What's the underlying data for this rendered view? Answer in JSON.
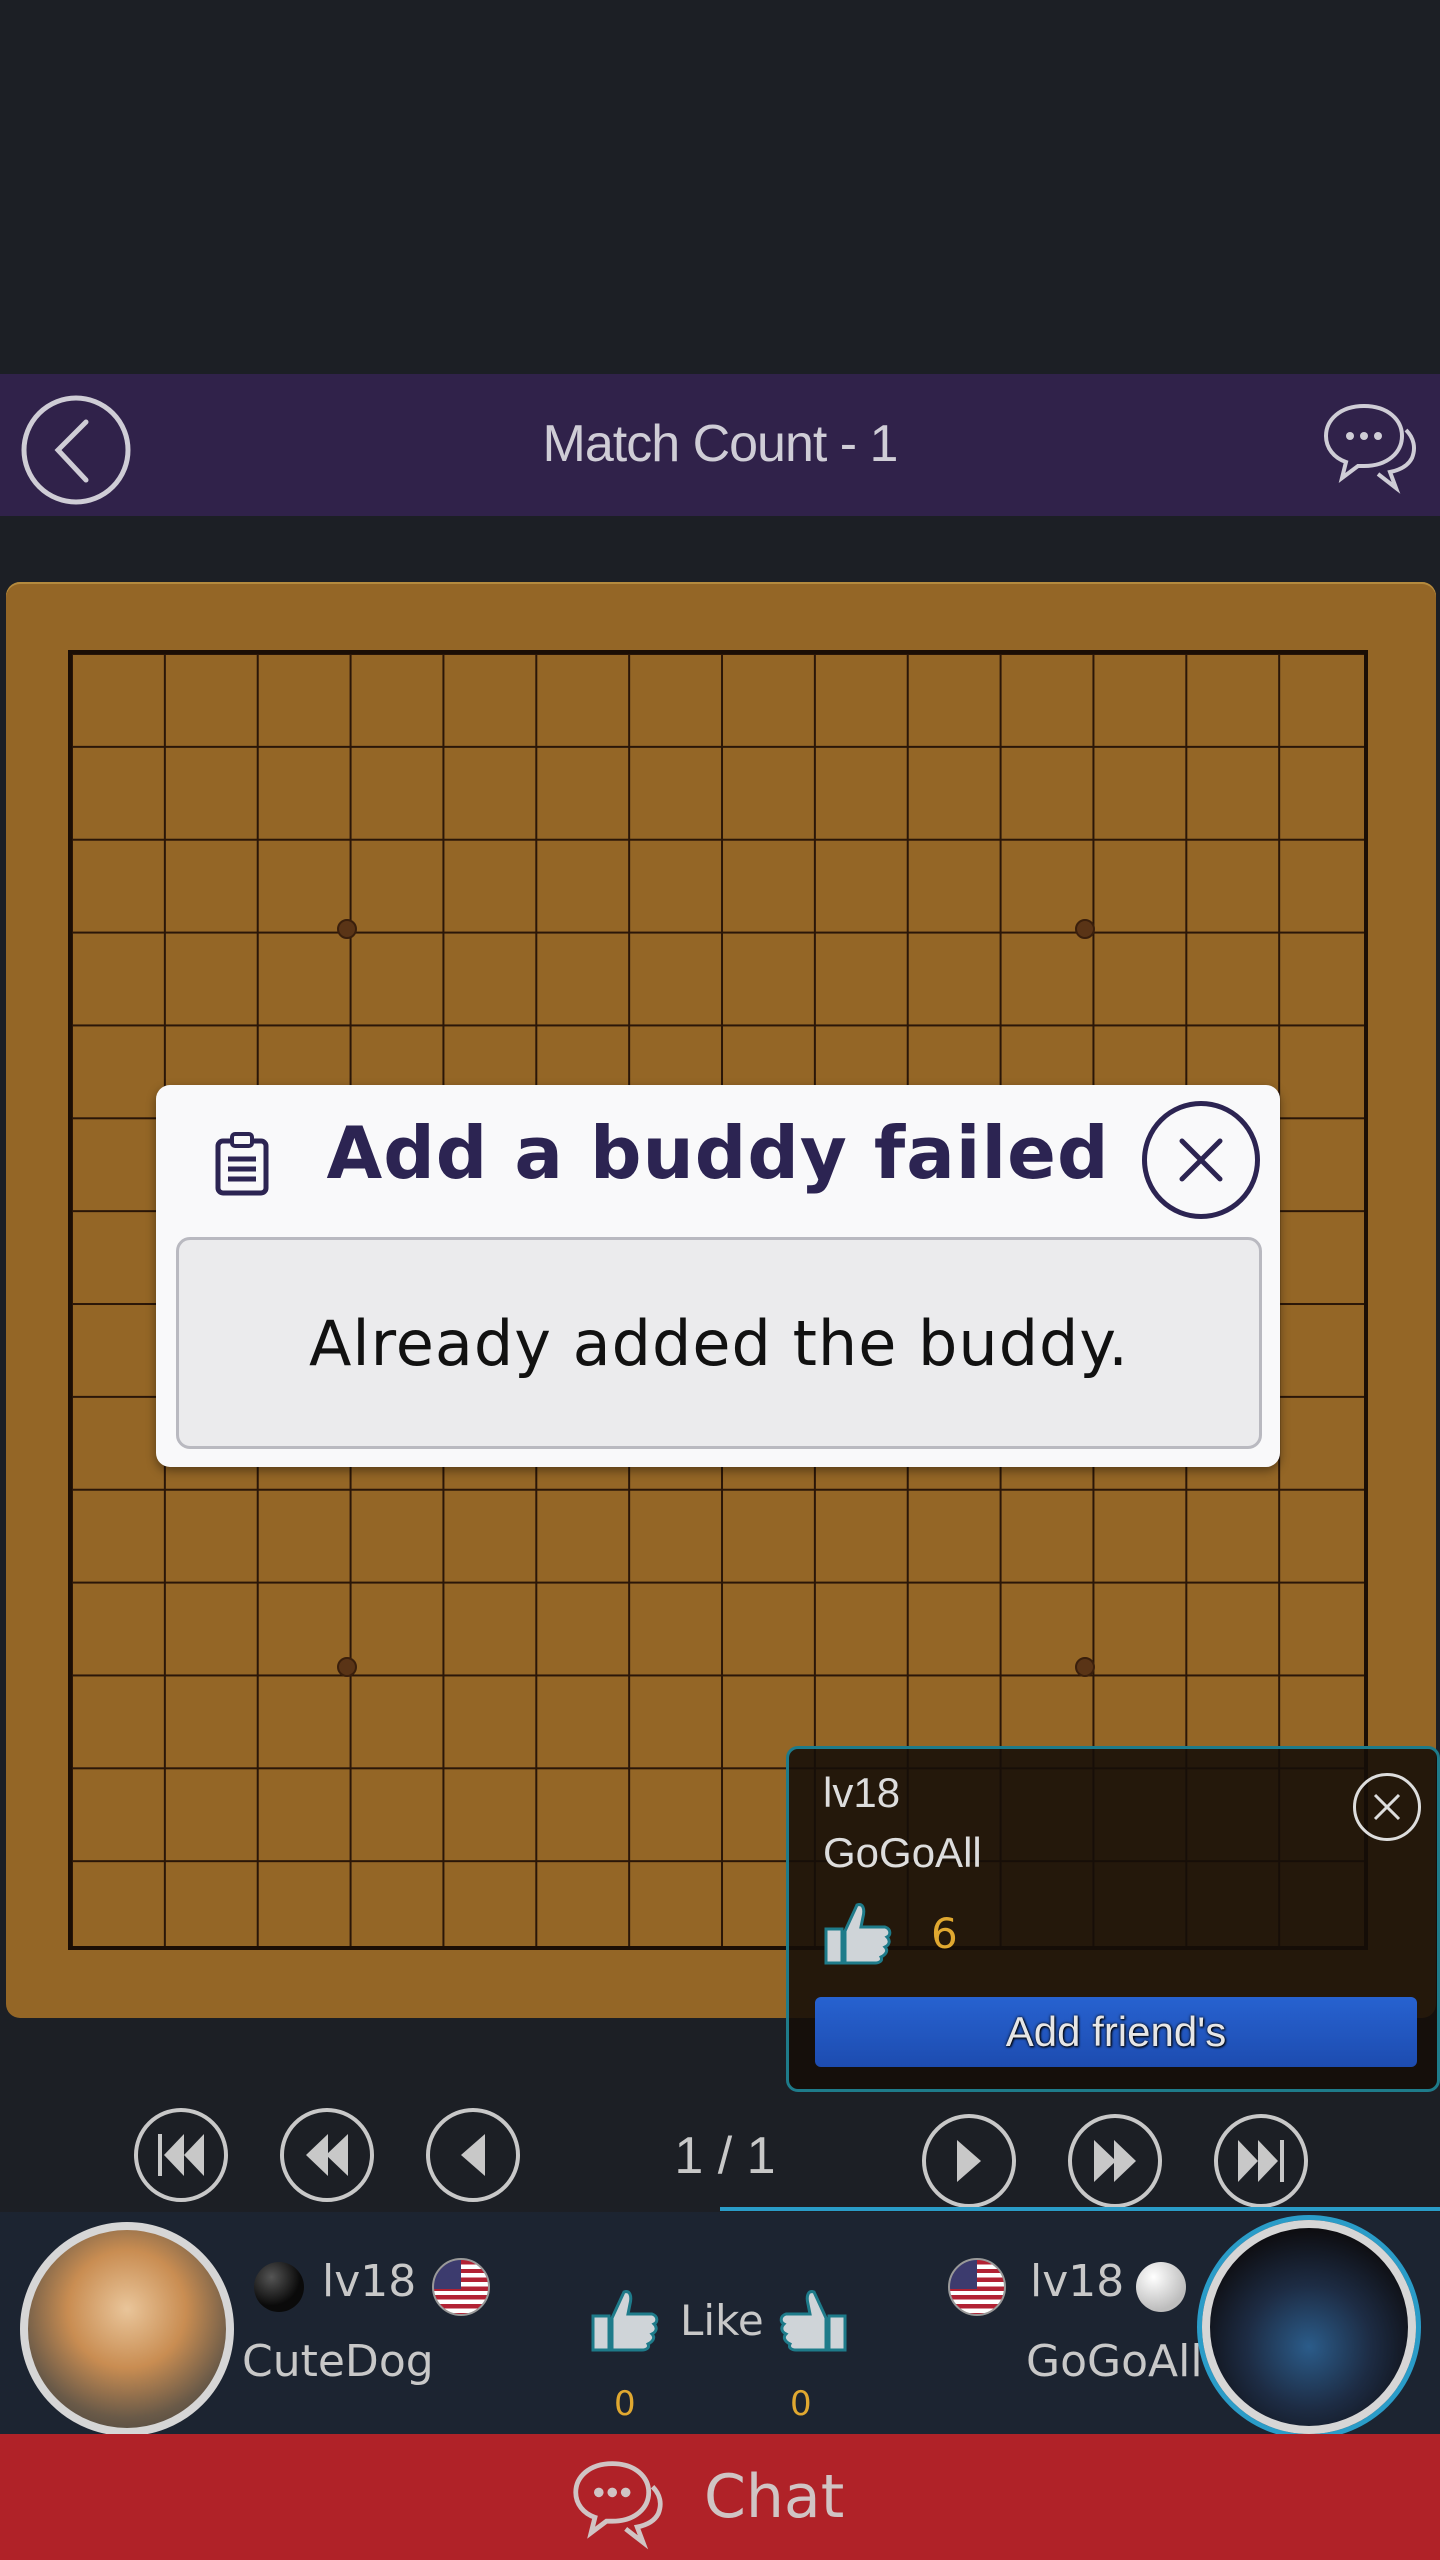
{
  "header": {
    "title": "Match Count - 1",
    "back_icon": "back-arrow-circle-icon",
    "chat_icon": "chat-bubbles-icon"
  },
  "board": {
    "size": 15,
    "star_points": [
      [
        3,
        3
      ],
      [
        3,
        11
      ],
      [
        11,
        3
      ],
      [
        11,
        11
      ]
    ],
    "colors": {
      "wood": "#946626",
      "line": "#2a1608",
      "star": "#5a3416"
    }
  },
  "dialog": {
    "icon": "clipboard-icon",
    "title": "Add a buddy failed",
    "message": "Already added the buddy.",
    "close_icon": "close-icon"
  },
  "player_popup": {
    "level": "lv18",
    "name": "GoGoAll",
    "likes": "6",
    "add_button": "Add friend's",
    "close_icon": "close-icon"
  },
  "controls": {
    "buttons": [
      {
        "name": "first-move",
        "icon": "skip-to-start-icon"
      },
      {
        "name": "rewind",
        "icon": "rewind-icon"
      },
      {
        "name": "previous",
        "icon": "previous-icon"
      },
      {
        "name": "next",
        "icon": "play-icon"
      },
      {
        "name": "fast-forward",
        "icon": "fast-forward-icon"
      },
      {
        "name": "last-move",
        "icon": "skip-to-end-icon"
      }
    ],
    "page": "1 / 1"
  },
  "players": {
    "left": {
      "level": "lv18",
      "name": "CuteDog",
      "stone": "black",
      "country": "US",
      "likes": "0"
    },
    "right": {
      "level": "lv18",
      "name": "GoGoAll",
      "stone": "white",
      "country": "US",
      "likes": "0"
    },
    "like_label": "Like"
  },
  "chat": {
    "label": "Chat"
  },
  "colors": {
    "header_bg": "#30224a",
    "chat_bg": "#b02228",
    "accent": "#2a9cc8",
    "add_button": "#2762d0",
    "like_count": "#e0a830"
  }
}
